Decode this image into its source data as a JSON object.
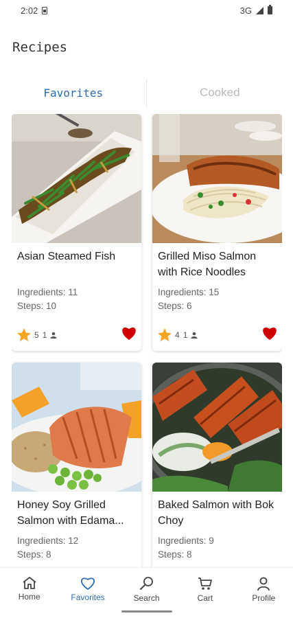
{
  "status": {
    "time": "2:02",
    "network": "3G"
  },
  "page_title": "Recipes",
  "tabs": [
    {
      "label": "Favorites",
      "active": true
    },
    {
      "label": "Cooked",
      "active": false
    }
  ],
  "recipes": [
    {
      "name": "Asian Steamed Fish",
      "ingredients": "Ingredients: 11",
      "steps": "Steps: 10",
      "rating": "5",
      "people": "1",
      "favorite": true
    },
    {
      "name": "Grilled Miso Salmon with Rice Noodles",
      "ingredients": "Ingredients: 15",
      "steps": "Steps: 6",
      "rating": "4",
      "people": "1",
      "favorite": true
    },
    {
      "name": "Honey Soy Grilled Salmon with Edama...",
      "ingredients": "Ingredients: 12",
      "steps": "Steps: 8"
    },
    {
      "name": "Baked Salmon with Bok Choy",
      "ingredients": "Ingredients: 9",
      "steps": "Steps: 8"
    }
  ],
  "nav": [
    {
      "label": "Home",
      "icon": "home-icon"
    },
    {
      "label": "Favorites",
      "icon": "heart-icon",
      "active": true
    },
    {
      "label": "Search",
      "icon": "search-icon"
    },
    {
      "label": "Cart",
      "icon": "cart-icon"
    },
    {
      "label": "Profile",
      "icon": "profile-icon"
    }
  ],
  "colors": {
    "accent": "#2b6cb0",
    "heart": "#d10000",
    "star": "#f5a623"
  }
}
